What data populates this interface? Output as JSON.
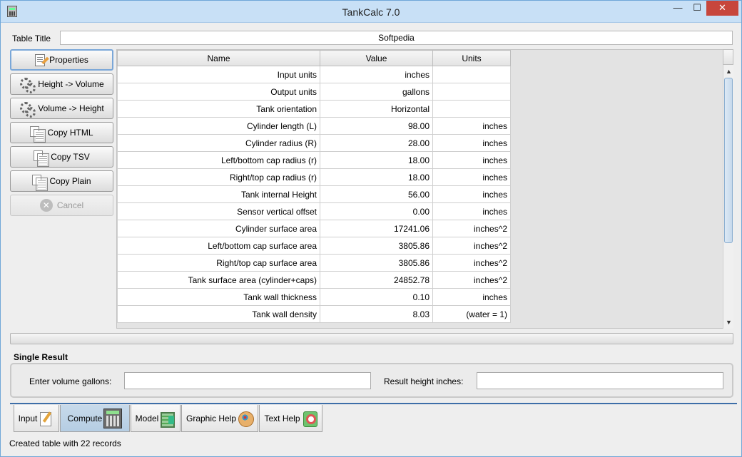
{
  "window": {
    "title": "TankCalc 7.0",
    "controls": {
      "minimize": "—",
      "maximize": "☐",
      "close": "✕"
    }
  },
  "table_title": {
    "label": "Table Title",
    "value": "Softpedia"
  },
  "side_buttons": {
    "properties": "Properties",
    "height_to_volume": "Height -> Volume",
    "volume_to_height": "Volume -> Height",
    "copy_html": "Copy HTML",
    "copy_tsv": "Copy TSV",
    "copy_plain": "Copy Plain",
    "cancel": "Cancel"
  },
  "table": {
    "columns": [
      "Name",
      "Value",
      "Units"
    ],
    "rows": [
      {
        "name": "Input units",
        "value": "inches",
        "units": ""
      },
      {
        "name": "Output units",
        "value": "gallons",
        "units": ""
      },
      {
        "name": "Tank orientation",
        "value": "Horizontal",
        "units": ""
      },
      {
        "name": "Cylinder length (L)",
        "value": "98.00",
        "units": "inches"
      },
      {
        "name": "Cylinder radius (R)",
        "value": "28.00",
        "units": "inches"
      },
      {
        "name": "Left/bottom cap radius (r)",
        "value": "18.00",
        "units": "inches"
      },
      {
        "name": "Right/top cap radius (r)",
        "value": "18.00",
        "units": "inches"
      },
      {
        "name": "Tank internal Height",
        "value": "56.00",
        "units": "inches"
      },
      {
        "name": "Sensor vertical offset",
        "value": "0.00",
        "units": "inches"
      },
      {
        "name": "Cylinder surface area",
        "value": "17241.06",
        "units": "inches^2"
      },
      {
        "name": "Left/bottom cap surface area",
        "value": "3805.86",
        "units": "inches^2"
      },
      {
        "name": "Right/top cap surface area",
        "value": "3805.86",
        "units": "inches^2"
      },
      {
        "name": "Tank surface area (cylinder+caps)",
        "value": "24852.78",
        "units": "inches^2"
      },
      {
        "name": "Tank wall thickness",
        "value": "0.10",
        "units": "inches"
      },
      {
        "name": "Tank wall density",
        "value": "8.03",
        "units": "(water = 1)"
      }
    ]
  },
  "single_result": {
    "label": "Single Result",
    "volume_label": "Enter volume gallons:",
    "volume_value": "",
    "height_label": "Result height inches:",
    "height_value": ""
  },
  "tabs": [
    {
      "label": "Input",
      "icon": "pencil-document-icon"
    },
    {
      "label": "Compute",
      "icon": "calculator-icon",
      "selected": true
    },
    {
      "label": "Model",
      "icon": "model-icon"
    },
    {
      "label": "Graphic Help",
      "icon": "palette-icon"
    },
    {
      "label": "Text Help",
      "icon": "help-icon"
    }
  ],
  "status": "Created table with 22 records"
}
